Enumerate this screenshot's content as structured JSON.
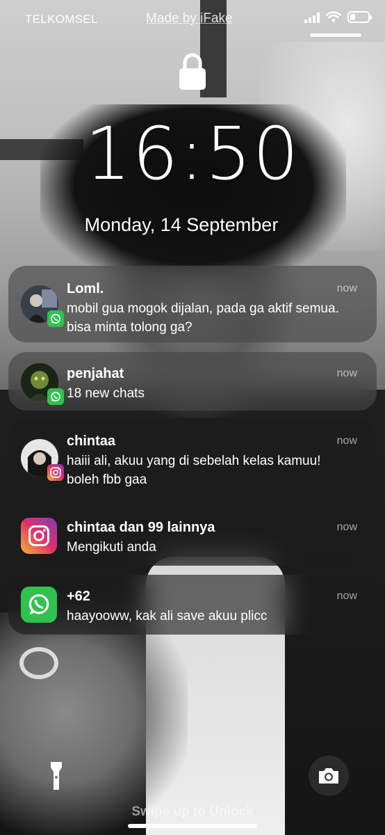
{
  "status_bar": {
    "carrier": "TELKOMSEL",
    "watermark": "Made by iFake",
    "battery_level": 0.3
  },
  "lock_screen": {
    "time": "16:50",
    "date": "Monday, 14 September",
    "swipe_hint": "Swipe up to Unlock"
  },
  "notifications": [
    {
      "app": "whatsapp",
      "title": "Loml.",
      "time": "now",
      "body": "mobil gua mogok dijalan, pada ga aktif semua. bisa minta tolong ga?"
    },
    {
      "app": "whatsapp",
      "title": "penjahat",
      "time": "now",
      "body": "18 new chats"
    },
    {
      "app": "instagram",
      "title": "chintaa",
      "time": "now",
      "body": "haiii ali, akuu yang di sebelah kelas kamuu! boleh fbb gaa"
    },
    {
      "app": "instagram",
      "title": "chintaa dan 99 lainnya",
      "time": "now",
      "body": "Mengikuti anda"
    },
    {
      "app": "whatsapp",
      "title": "+62",
      "time": "now",
      "body": "haayooww, kak ali save akuu plicc"
    }
  ],
  "icons": {
    "lock": "lock-icon",
    "flashlight": "flashlight-icon",
    "camera": "camera-icon"
  },
  "colors": {
    "whatsapp_green": "#2fc24f",
    "instagram_pink": "#e1306c"
  }
}
